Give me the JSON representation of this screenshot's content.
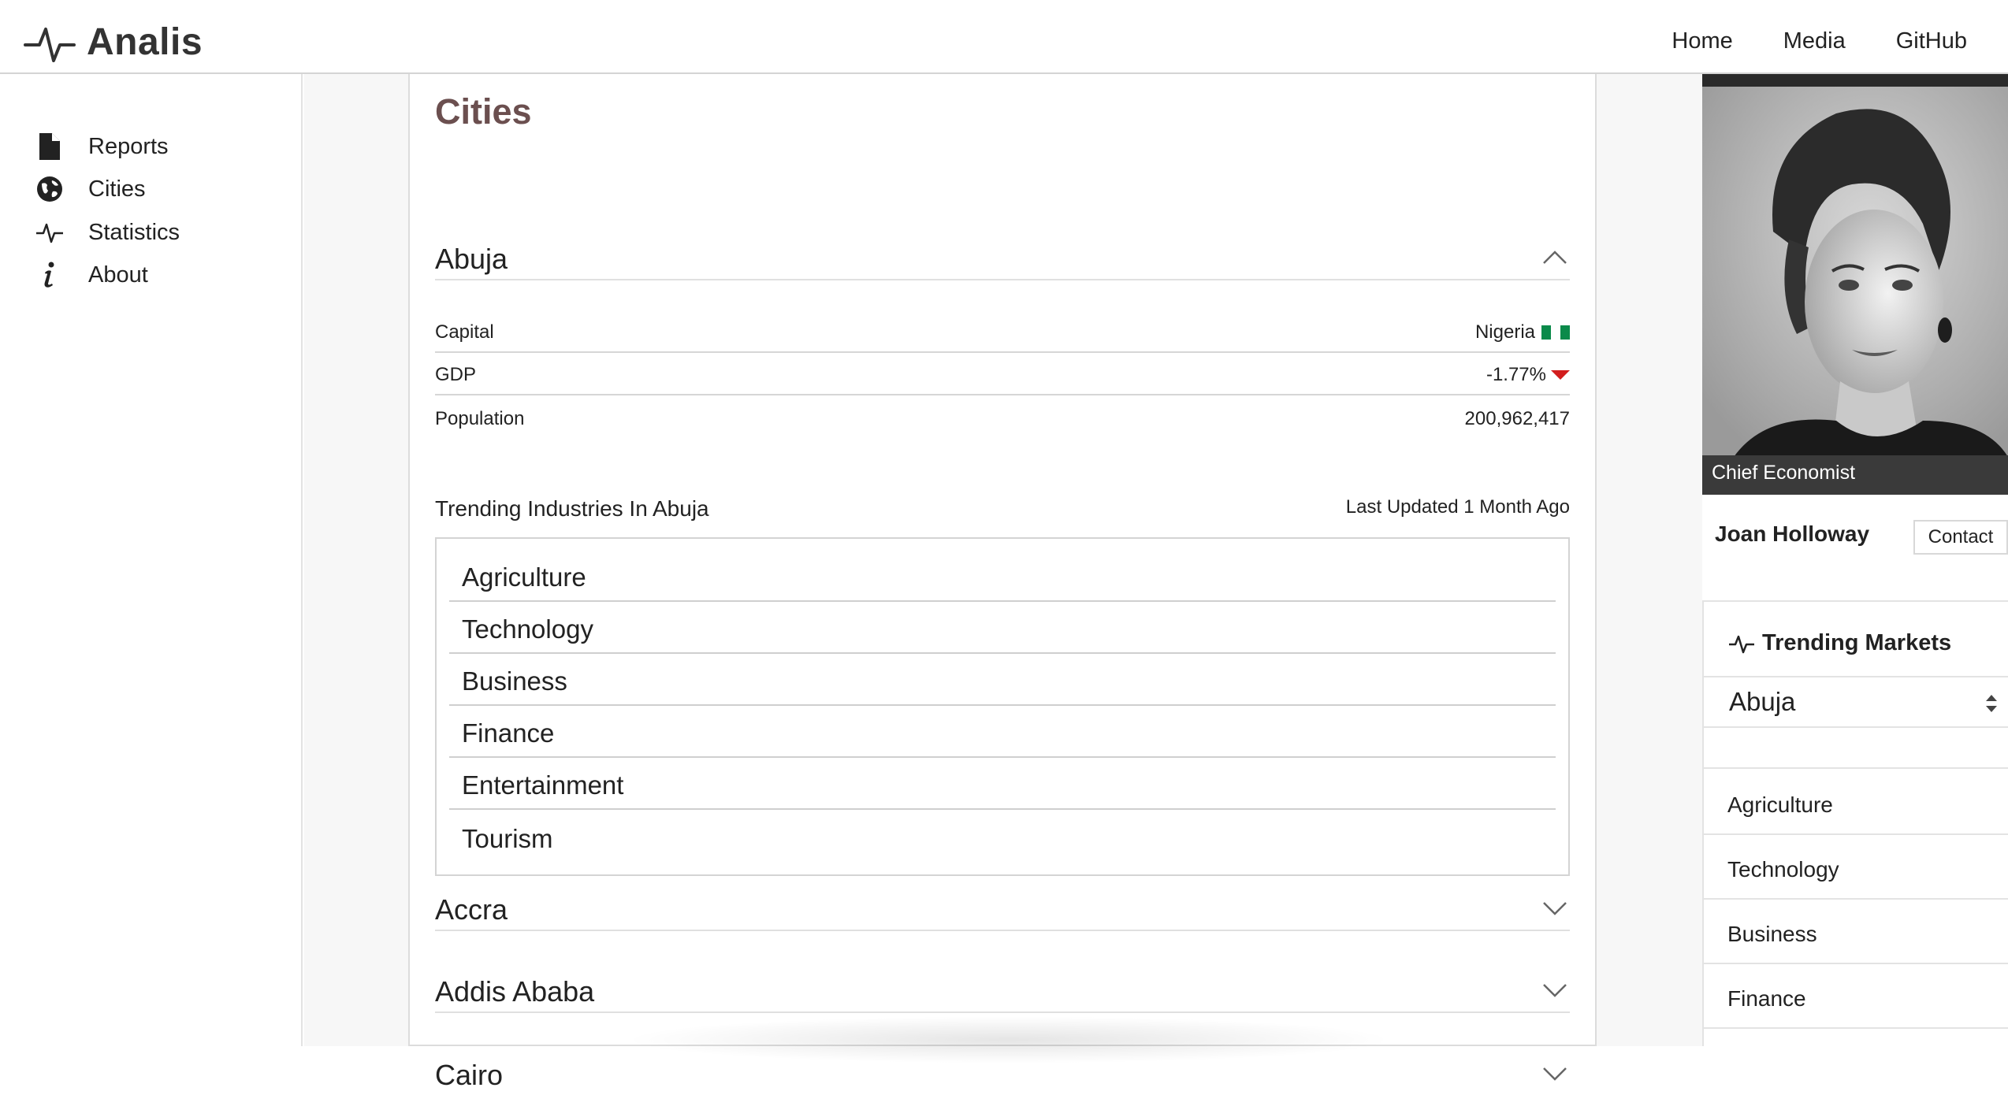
{
  "app": {
    "name": "Analis"
  },
  "topnav": [
    {
      "label": "Home"
    },
    {
      "label": "Media"
    },
    {
      "label": "GitHub"
    }
  ],
  "sidebar": {
    "items": [
      {
        "label": "Reports",
        "icon": "file-icon"
      },
      {
        "label": "Cities",
        "icon": "globe-icon"
      },
      {
        "label": "Statistics",
        "icon": "pulse-icon"
      },
      {
        "label": "About",
        "icon": "info-icon"
      }
    ]
  },
  "main": {
    "title": "Cities",
    "expanded_city": {
      "name": "Abuja",
      "details": [
        {
          "key": "Capital",
          "value": "Nigeria",
          "flag": "Nigeria flag (green-white-green)"
        },
        {
          "key": "GDP",
          "value": "-1.77%",
          "trend": "down",
          "trend_color": "#d21d1d"
        },
        {
          "key": "Population",
          "value": "200,962,417"
        }
      ],
      "trending_title": "Trending Industries In Abuja",
      "last_updated": "Last Updated 1 Month Ago",
      "industries": [
        "Agriculture",
        "Technology",
        "Business",
        "Finance",
        "Entertainment",
        "Tourism"
      ]
    },
    "collapsed_cities": [
      "Accra",
      "Addis Ababa",
      "Cairo"
    ]
  },
  "profile": {
    "caption": "Chief Economist",
    "name": "Joan Holloway",
    "contact_label": "Contact"
  },
  "trending_markets": {
    "title": "Trending Markets",
    "selected_city": "Abuja",
    "items": [
      "Agriculture",
      "Technology",
      "Business",
      "Finance"
    ]
  },
  "colors": {
    "title_accent": "#6b4f4f",
    "down_trend": "#d21d1d",
    "flag_green": "#0b8a4a"
  }
}
